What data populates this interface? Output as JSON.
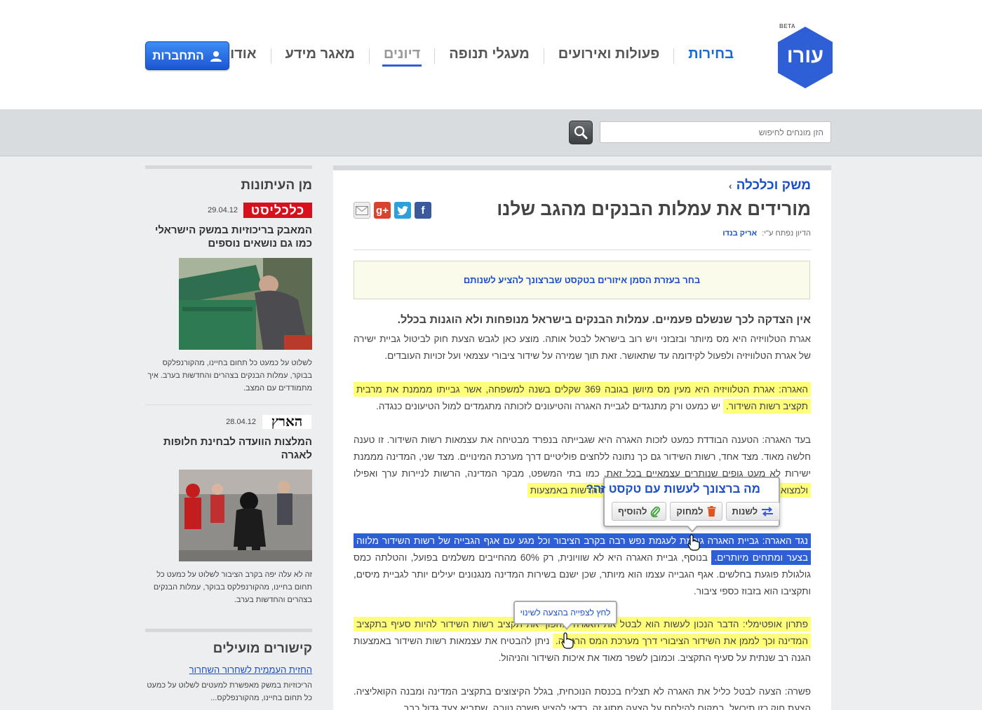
{
  "header": {
    "logo_text": "עורו",
    "beta": "BETA",
    "nav": [
      {
        "label": "אודות עורו"
      },
      {
        "label": "מאגר מידע"
      },
      {
        "label": "דיונים"
      },
      {
        "label": "מעגלי תנופה"
      },
      {
        "label": "פעולות ואירועים"
      },
      {
        "label": "בחירות"
      }
    ],
    "login_label": "התחברות"
  },
  "search": {
    "placeholder": "הזן מונחים לחיפוש"
  },
  "sidebar": {
    "news_title": "מן העיתונות",
    "news": [
      {
        "source": "כלכליסט",
        "date": "29.04.12",
        "title": "המאבק בריכוזיות במשק הישראלי כמו גם נושאים נוספים",
        "text": "לשלוט על כמעט כל תחום בחיינו, מהקורנפלקס בבוקר, עמלות הבנקים בצהרים והחדשות בערב. איך מתמודדים עם המצב."
      },
      {
        "source": "הארץ",
        "date": "28.04.12",
        "title": "המלצות הוועדה לבחינת חלופות לאגרה",
        "text": "זה לא עלה יפה בקרב הציבור לשלוט על כמעט כל תחום בחיינו, מהקורנפלקס בבוקר, עמלות הבנקים בצהרים והחדשות בערב."
      }
    ],
    "links_title": "קישורים מועילים",
    "links": [
      {
        "label": "החזית העממית לשחרור השחרור",
        "text": "הריכוזיות במשק מאפשרת למעטים לשלוט על כמעט כל תחום בחיינו, מהקורנפלקס..."
      }
    ]
  },
  "article": {
    "breadcrumb": "משק וכלכלה",
    "title": "מורידים את עמלות הבנקים מהגב שלנו",
    "byline_prefix": "הדיון נפתח ע\"י:",
    "author": "אריק בנדו",
    "hint": "בחר בעזרת הסמן איזורים בטקסט שברצונך להציע לשנותם",
    "lead": "אין הצדקה לכך שנשלם פעמיים. עמלות הבנקים בישראל מנופחות ולא הוגנות בכלל.",
    "p1": "אגרת הטלוויזיה היא מס מיותר ובזבזני ויש רוב בישראל לבטל אותה. מוצע כאן לגבש הצעת חוק לביטול גביית ישירה של אגרת הטלוויזיה ולפעול לקידומה עד שתאושר. זאת תוך שמירה על שידור ציבורי עצמאי ועל זכויות העובדים.",
    "p2_hl": "האגרה: אגרת הטלוויזיה היא מעין מס מיושן בגובה 369 שקלים בשנה למשפחה, אשר גבייתו מממנת את מרבית תקציב רשות השידור.",
    "p2_rest": "יש כמעט ורק מתנגדים לגביית האגרה והטיעונים לזכותה מתגמדים למול הטיעונים כנגדה.",
    "p3_start": "בעד האגרה: הטענה הבודדת כמעט לזכות האגרה היא שגבייתה בנפרד מבטיחה את עצמאות רשות השידור. זו טענה חלשה מאוד. מצד אחד, רשות השידור גם כך נתונה ללחצים פוליטיים דרך מערכת המינויים. מצד שני, המדינה מממנת ישירות לא מעט גופים שנותרים עצמאיים בכל זאת, כמו בתי המשפט, מבקר המדינה, הרשות לניירות ערך ואפילו",
    "p3_hl": "ולמצוא מקור תקציבי חליפי, ניתן להבטיח את עצמאות הרשות באמצעות",
    "p4_sel": "נגד האגרה: גביית האגרה גורמת לעגמת נפש רבה בקרב הציבור וכל מגע עם אגף הגבייה של רשות השידור מלווה בצער ומתחים מיותרים.",
    "p4_rest": "בנוסף, גביית האגרה היא לא שוויונית, רק 60% מהחייבים משלמים בפועל, והטלתה כמס גולגולת פוגעת בחלשים. אגף הגבייה עצמו הוא מיותר, שכן ישנם בשירות המדינה מנגנונים יעילים יותר לגביית מיסים, ותקציבו הוא בזבוז כספי ציבור.",
    "p5_hl": "פתרון אופטימלי: הדבר הנכון לעשות הוא לבטל את האגרה ולהפוך את תקציב רשות השידור להיות סעיף בתקציב המדינה וכך לממן את השידור הציבורי דרך מערכת המס הרגילה.",
    "p5_rest": "ניתן להבטיח את עצמאות רשות השידור באמצעות הגנה רב שנתית על סעיף התקציב. וכמובן לשפר מאוד את איכות השידור והניהול.",
    "p6": "פשרה: הצעה לבטל כליל את האגרה לא תצליח בכנסת הנוכחית, בגלל הקיצוצים בתקציב המדינה ומבנה הקואליציה. הצעת חוק כזו תיכשל, במקום להילחם על הצעה מסוג זה, כדאי להציע פשרה טובה, שתביא צעד גדול כבר"
  },
  "action_popup": {
    "question": "מה ברצונך לעשות עם טקסט זה?",
    "change": "לשנות",
    "delete": "למחוק",
    "add": "להוסיף"
  },
  "tip_popup": {
    "text": "לחץ לצפייה בהצעה לשינוי"
  },
  "colors": {
    "brand_blue": "#2f5fd6",
    "highlight_yellow": "#ffff7a",
    "link_blue": "#1a4fc8",
    "calcalist_red": "#d8101d"
  }
}
